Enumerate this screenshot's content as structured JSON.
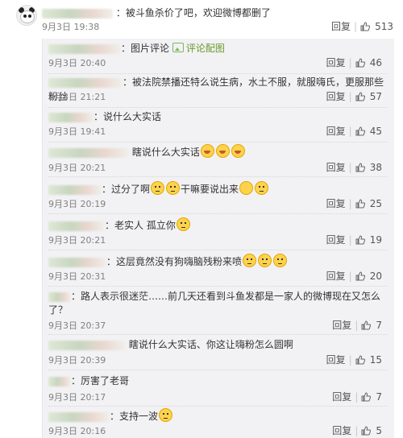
{
  "top_comment": {
    "text": "：被斗鱼杀价了吧，欢迎微博都删了",
    "time": "9月3日 19:38",
    "reply": "回复",
    "likes": "513"
  },
  "replies": [
    {
      "text": "：图片评论",
      "link": "评论配图",
      "time": "9月3日 20:40",
      "reply": "回复",
      "likes": "46"
    },
    {
      "text": "：被法院禁播还特么说生病，水土不服，就服嗨氏，更服那些粉丝",
      "time": "9月3日 21:21",
      "reply": "回复",
      "likes": "57"
    },
    {
      "text": "：说什么大实话",
      "time": "9月3日 19:41",
      "reply": "回复",
      "likes": "45"
    },
    {
      "text": "瞎说什么大实话",
      "time": "9月3日 20:21",
      "reply": "回复",
      "likes": "38"
    },
    {
      "text": "：过分了啊",
      "text2": "干嘛要说出来",
      "time": "9月3日 20:19",
      "reply": "回复",
      "likes": "25"
    },
    {
      "text": "：老实人 孤立你",
      "time": "9月3日 20:21",
      "reply": "回复",
      "likes": "19"
    },
    {
      "text": "：这层竟然没有狗嗨脑残粉来喷",
      "time": "9月3日 20:31",
      "reply": "回复",
      "likes": "20"
    },
    {
      "text": "：路人表示很迷茫……前几天还看到斗鱼发都是一家人的微博现在又怎么",
      "text_cont": "了？",
      "time": "9月3日 20:37",
      "reply": "回复",
      "likes": "7"
    },
    {
      "text": "瞎说什么大实话、你这让嗨粉怎么圆啊",
      "time": "9月3日 20:39",
      "reply": "回复",
      "likes": "15"
    },
    {
      "text": "：厉害了老哥",
      "time": "9月3日 20:17",
      "reply": "回复",
      "likes": "7"
    },
    {
      "text": "：支持一波",
      "time": "9月3日 20:16",
      "reply": "回复",
      "likes": "5"
    }
  ],
  "icons": {
    "like": "thumbs-up-icon",
    "avatar": "panda-avatar",
    "image": "image-icon",
    "emoji": "emoji-icon"
  },
  "colors": {
    "panel_bg": "#f2f2f5",
    "link": "#6a9a2a",
    "meta": "#808080"
  }
}
